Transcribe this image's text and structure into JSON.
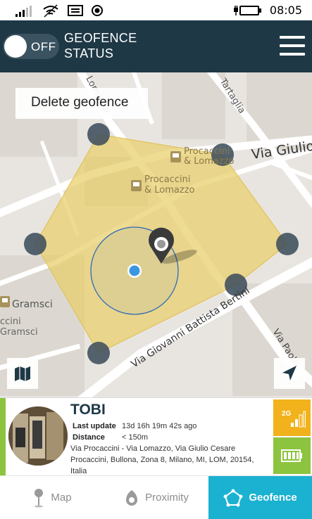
{
  "status_bar": {
    "time": "08:05"
  },
  "header": {
    "toggle_label": "OFF",
    "title_line1": "GEOFENCE",
    "title_line2": "STATUS"
  },
  "map": {
    "delete_label": "Delete geofence",
    "labels": {
      "poi1_line1": "Procaccini",
      "poi1_line2": "& Lomazzo",
      "poi2_line1": "Procaccini",
      "poi2_line2": "& Lomazzo",
      "gramsci1": "Gramsci",
      "gramsci2_line1": "ccini",
      "gramsci2_line2": "Gramsci",
      "via_giulio": "Via Giulio",
      "tartaglia": "Tartaglia",
      "lomazzo": "Lomazzo",
      "bertini": "Via Giovanni Battista Bertini",
      "via_paolo": "Via Paolo"
    }
  },
  "device": {
    "name": "TOBI",
    "last_update_label": "Last update",
    "last_update_value": "13d 16h 19m 42s ago",
    "distance_label": "Distance",
    "distance_value": "< 150m",
    "address": "Via Procaccini - Via Lomazzo, Via Giulio Cesare Procaccini, Bullona, Zona 8, Milano, MI, LOM, 20154, Italia",
    "signal_label": "2G"
  },
  "tabs": {
    "map": "Map",
    "proximity": "Proximity",
    "geofence": "Geofence"
  },
  "colors": {
    "header_bg": "#1e3846",
    "geofence_fill": "#e9cf6a",
    "accent_green": "#8cc43f",
    "accent_yellow": "#f2b21c",
    "active_tab": "#1bb2d1"
  }
}
